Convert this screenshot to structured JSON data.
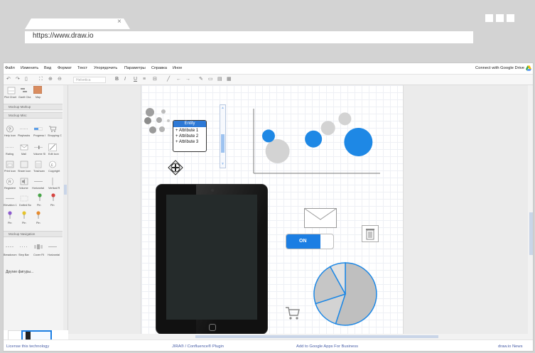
{
  "browser": {
    "url": "https://www.draw.io",
    "tab_close": "×"
  },
  "menu": {
    "items": [
      "Файл",
      "Изменить",
      "Вид",
      "Формат",
      "Текст",
      "Упорядочить",
      "Параметры",
      "Справка",
      "Иное"
    ],
    "drive_link": "Connect with Google Drive"
  },
  "toolbar": {
    "font": "Helvetica",
    "icons": [
      "undo-icon",
      "redo-icon",
      "delete-icon",
      "fit-icon",
      "zoom-in-icon",
      "zoom-out-icon",
      "bold-icon",
      "italic-icon",
      "underline-icon",
      "align-icon",
      "line-icon",
      "arrow-left-icon",
      "arrow-right-icon",
      "fill-icon",
      "style-icon",
      "format-icon",
      "grid-icon"
    ],
    "bold": "B",
    "italic": "I",
    "underline": "U"
  },
  "sidebar": {
    "top_labels": [
      "Plot Chart",
      "Gantt Cha",
      "Map"
    ],
    "sections": [
      "Mockup Markup",
      "Mockup Misc",
      "Mockup Navigation"
    ],
    "misc_row1": [
      "Help Icon",
      "Playbacks",
      "Progress I",
      "Shopping C"
    ],
    "misc_row2": [
      "Rating",
      "Mail",
      "Volume Sl",
      "Edit Icon"
    ],
    "misc_row3": [
      "Print Icon",
      "Share Icon",
      "Trashcan",
      "Copyright"
    ],
    "misc_row4": [
      "Registere",
      "Volume",
      "Horizontal",
      "Vertical R"
    ],
    "misc_row5": [
      "Elevation 1",
      "Dotted Bo",
      "Pin",
      "Pin"
    ],
    "misc_row6": [
      "Pin",
      "Pin",
      "Pin"
    ],
    "nav_row1": [
      "Breadcrum",
      "Step Bar",
      "Cover Fli",
      "Horizontal"
    ],
    "more_shapes": "Другие фигуры..."
  },
  "canvas": {
    "entity": {
      "title": "Entity",
      "attributes": [
        "+ Attribute 1",
        "+ Attribute 2",
        "+ Attribute 3"
      ]
    },
    "toggle_label": "ON",
    "bubble_chart": {
      "points": [
        {
          "x": 0.2,
          "y": 0.35,
          "r": 17,
          "color": "#d3d3d3"
        },
        {
          "x": 0.52,
          "y": 0.55,
          "r": 12,
          "color": "#1e88e5"
        },
        {
          "x": 0.65,
          "y": 0.73,
          "r": 10,
          "color": "#d3d3d3"
        },
        {
          "x": 0.8,
          "y": 0.88,
          "r": 9,
          "color": "#d3d3d3"
        },
        {
          "x": 0.92,
          "y": 0.5,
          "r": 20,
          "color": "#1e88e5"
        },
        {
          "x": 0.12,
          "y": 0.6,
          "r": 9,
          "color": "#1e88e5"
        }
      ],
      "colors": {
        "accent": "#1e88e5",
        "neutral": "#d3d3d3"
      }
    },
    "pie": {
      "slices": [
        0.55,
        0.15,
        0.22,
        0.08
      ],
      "colors": [
        "#bfbfbf",
        "#d3d3d3",
        "#c6c6c6",
        "#e1e1e1"
      ],
      "stroke": "#1e88e5"
    }
  },
  "footer": {
    "license": "License this technology",
    "plugin": "JIRA® / Confluence® Plugin",
    "google_apps": "Add to Google Apps For Business",
    "news": "draw.io News"
  }
}
